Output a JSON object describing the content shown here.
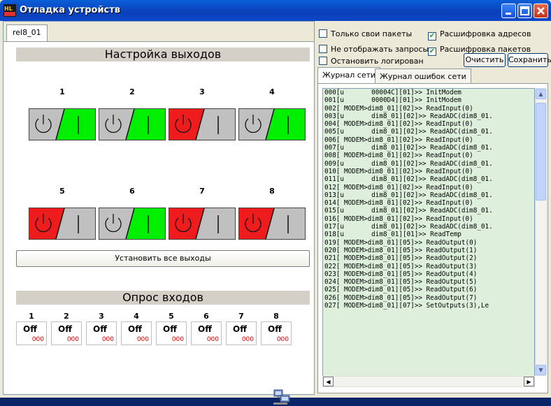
{
  "window": {
    "title": "Отладка устройств"
  },
  "device_tab": "rel8_01",
  "outputs": {
    "header": "Настройка выходов",
    "channels": [
      {
        "num": "1",
        "state": "on"
      },
      {
        "num": "2",
        "state": "on"
      },
      {
        "num": "3",
        "state": "off"
      },
      {
        "num": "4",
        "state": "on"
      },
      {
        "num": "5",
        "state": "off"
      },
      {
        "num": "6",
        "state": "on"
      },
      {
        "num": "7",
        "state": "off"
      },
      {
        "num": "8",
        "state": "off"
      }
    ],
    "set_all_label": "Установить все выходы"
  },
  "inputs": {
    "header": "Опрос входов",
    "channels": [
      {
        "num": "1",
        "state": "Off",
        "count": "000"
      },
      {
        "num": "2",
        "state": "Off",
        "count": "000"
      },
      {
        "num": "3",
        "state": "Off",
        "count": "000"
      },
      {
        "num": "4",
        "state": "Off",
        "count": "000"
      },
      {
        "num": "5",
        "state": "Off",
        "count": "000"
      },
      {
        "num": "6",
        "state": "Off",
        "count": "000"
      },
      {
        "num": "7",
        "state": "Off",
        "count": "000"
      },
      {
        "num": "8",
        "state": "Off",
        "count": "000"
      }
    ]
  },
  "options": {
    "own_packets": {
      "label": "Только свои пакеты",
      "checked": false
    },
    "decode_addresses": {
      "label": "Расшифровка адресов",
      "checked": true
    },
    "hide_requests": {
      "label": "Не отображать запросы",
      "checked": false
    },
    "decode_packets": {
      "label": "Расшифровка пакетов",
      "checked": true
    },
    "stop_logging": {
      "label": "Остановить логирован",
      "checked": false
    }
  },
  "buttons": {
    "clear": "Очистить",
    "save": "Сохранить"
  },
  "log_tabs": [
    "Журнал сети",
    "Журнал ошибок сети"
  ],
  "log": [
    "000[u       00004C][01]>> InitModem",
    "001[u       0000D4][01]>> InitModem",
    "002[ MODEM>dim8_01][02]>> ReadInput(0)",
    "003[u       dim8_01][02]>> ReadADC(dim8_01.",
    "004[ MODEM>dim8_01][02]>> ReadInput(0)",
    "005[u       dim8_01][02]>> ReadADC(dim8_01.",
    "006[ MODEM>dim8_01][02]>> ReadInput(0)",
    "007[u       dim8_01][02]>> ReadADC(dim8_01.",
    "008[ MODEM>dim8_01][02]>> ReadInput(0)",
    "009[u       dim8_01][02]>> ReadADC(dim8_01.",
    "010[ MODEM>dim8_01][02]>> ReadInput(0)",
    "011[u       dim8_01][02]>> ReadADC(dim8_01.",
    "012[ MODEM>dim8_01][02]>> ReadInput(0)",
    "013[u       dim8_01][02]>> ReadADC(dim8_01.",
    "014[ MODEM>dim8_01][02]>> ReadInput(0)",
    "015[u       dim8_01][02]>> ReadADC(dim8_01.",
    "016[ MODEM>dim8_01][02]>> ReadInput(0)",
    "017[u       dim8_01][02]>> ReadADC(dim8_01.",
    "018[u       dim8_01][01]>> ReadTemp",
    "019[ MODEM>dim8_01][05]>> ReadOutput(0)",
    "020[ MODEM>dim8_01][05]>> ReadOutput(1)",
    "021[ MODEM>dim8_01][05]>> ReadOutput(2)",
    "022[ MODEM>dim8_01][05]>> ReadOutput(3)",
    "023[ MODEM>dim8_01][05]>> ReadOutput(4)",
    "024[ MODEM>dim8_01][05]>> ReadOutput(5)",
    "025[ MODEM>dim8_01][05]>> ReadOutput(6)",
    "026[ MODEM>dim8_01][05]>> ReadOutput(7)",
    "027[ MODEM>dim8_01][07]>> SetOutputs(3),Le"
  ],
  "colors": {
    "on": "#00ee00",
    "off": "#ee1c1c",
    "neutral": "#c0c0c0",
    "log_bg": "#dcf0dc",
    "header_bg": "#d4d0c8"
  },
  "icons": [
    "app-icon",
    "minimize-icon",
    "maximize-icon",
    "close-icon",
    "network-icon",
    "power-icon"
  ]
}
